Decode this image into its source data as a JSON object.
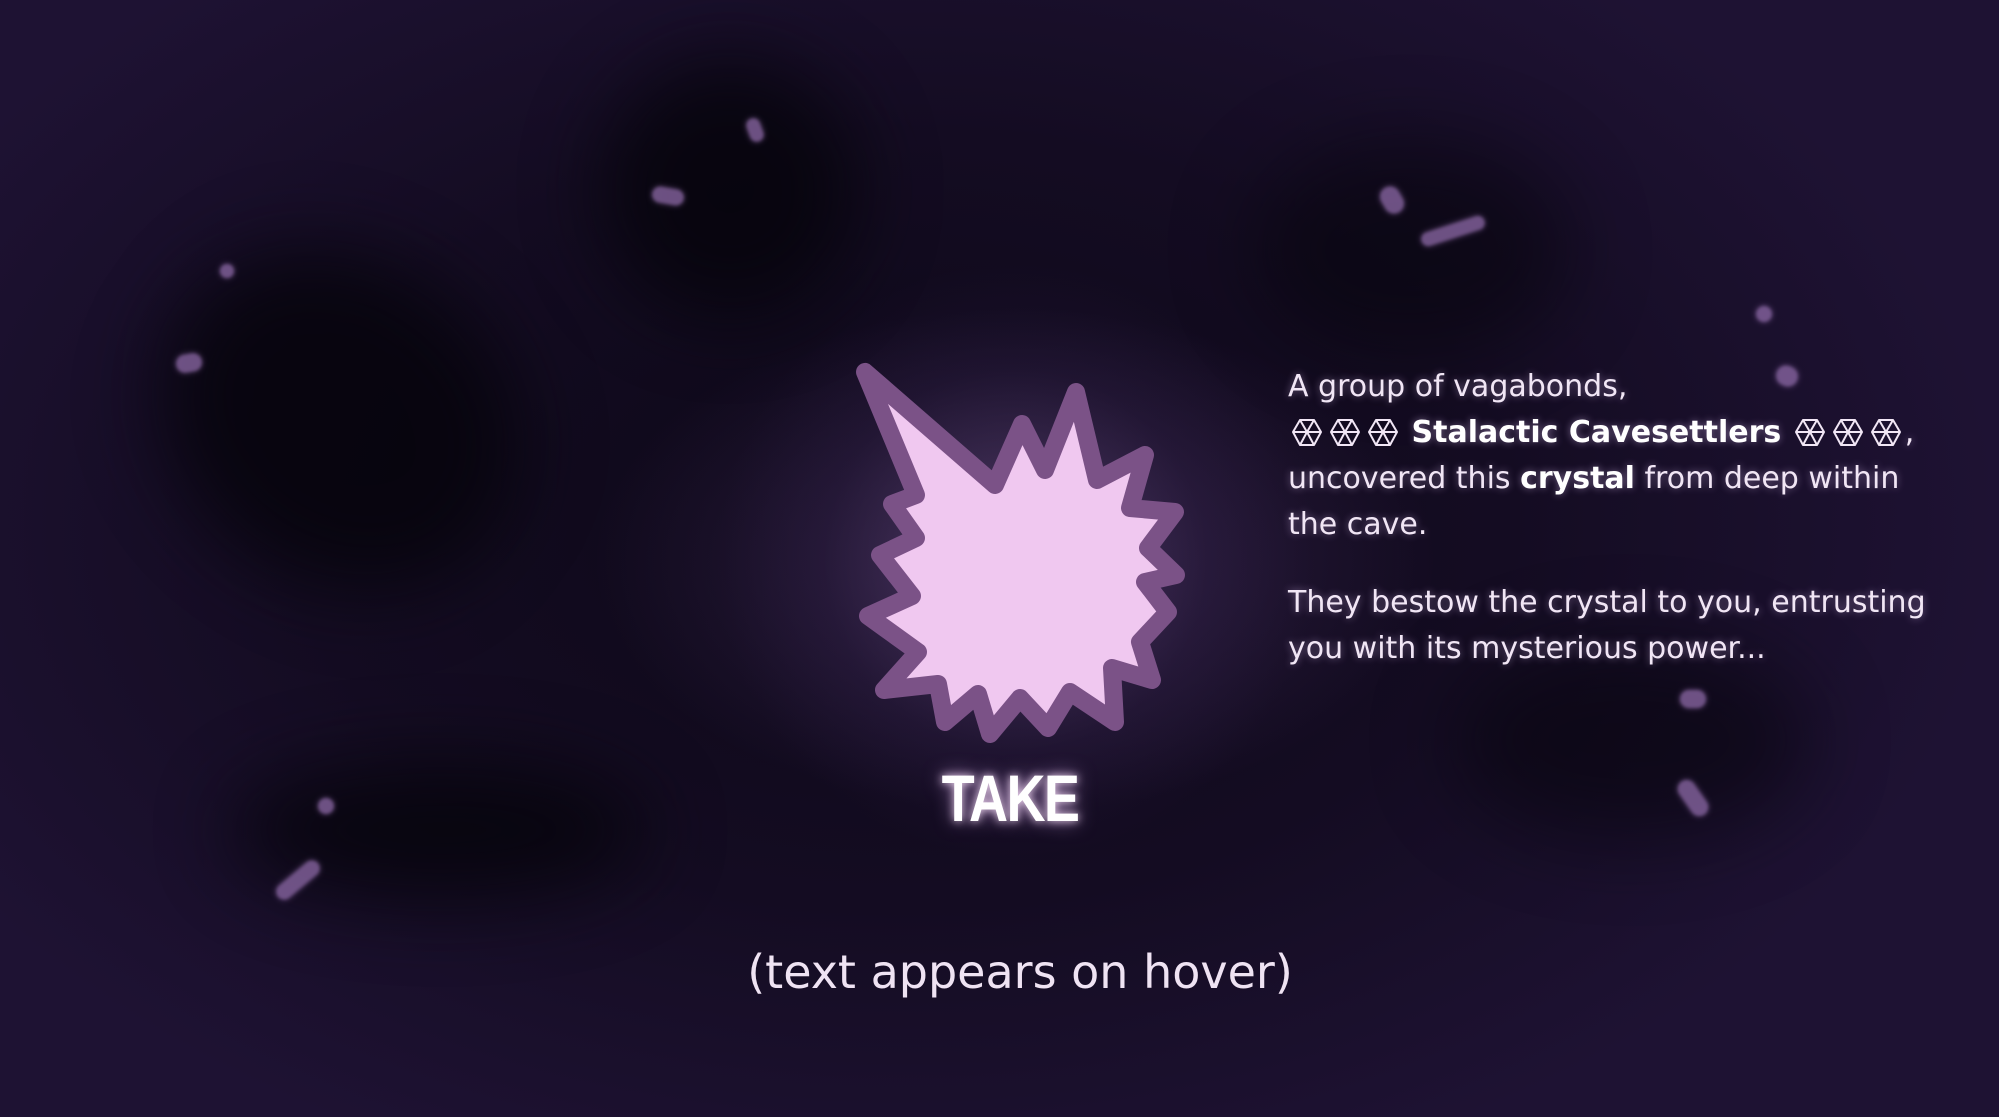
{
  "action": {
    "take_label": "TAKE"
  },
  "story": {
    "line1": "A group of vagabonds,",
    "group_name": "Stalactic Cavesettlers",
    "trailing_comma": ",",
    "line3_pre": "uncovered this",
    "crystal_word": "crystal",
    "line3_post": "from deep within the cave.",
    "paragraph2": "They bestow the crystal to you, entrusting you with its mysterious power..."
  },
  "hint": "(text appears on hover)",
  "colors": {
    "burst_fill": "#f0c8f0",
    "burst_outline": "#7b5287",
    "background": "#140c22",
    "text": "#f1e6f5"
  },
  "icons": {
    "crystal": "crystal-icon",
    "burst": "starburst-icon"
  }
}
